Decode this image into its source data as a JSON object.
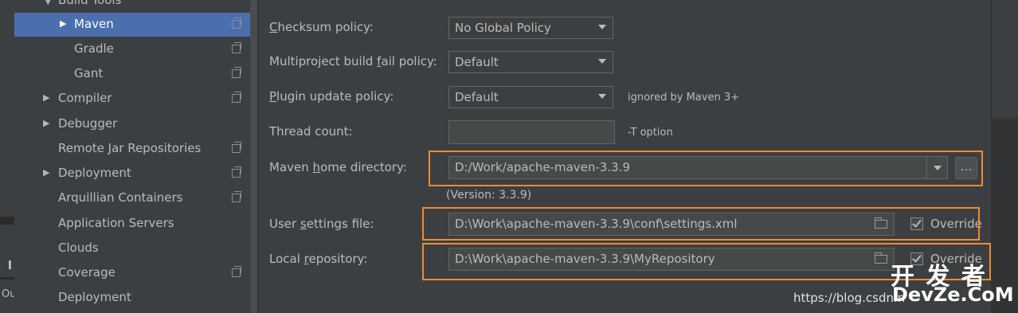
{
  "left_edge": {
    "top_label": "l",
    "bottom_label": "Ou"
  },
  "sidebar": {
    "items": [
      {
        "label": "Build Tools",
        "expanded": true
      },
      {
        "label": "Maven",
        "selected": true,
        "collapsed": true
      },
      {
        "label": "Gradle"
      },
      {
        "label": "Gant"
      },
      {
        "label": "Compiler",
        "collapsed": true
      },
      {
        "label": "Debugger",
        "collapsed": true
      },
      {
        "label": "Remote Jar Repositories"
      },
      {
        "label": "Deployment",
        "collapsed": true
      },
      {
        "label": "Arquillian Containers"
      },
      {
        "label": "Application Servers"
      },
      {
        "label": "Clouds"
      },
      {
        "label": "Coverage"
      },
      {
        "label": "Deployment"
      }
    ]
  },
  "form": {
    "checksum": {
      "label_underlined": "C",
      "label_rest": "hecksum policy:",
      "value": "No Global Policy"
    },
    "multiproject": {
      "label_pre": "Multiproject build ",
      "label_underlined": "f",
      "label_rest": "ail policy:",
      "value": "Default"
    },
    "plugin": {
      "label_underlined": "P",
      "label_rest": "lugin update policy:",
      "value": "Default",
      "hint": "ignored by Maven 3+"
    },
    "thread": {
      "label": "Thread count:",
      "value": "",
      "hint": "-T option"
    },
    "maven_home": {
      "label_pre": "Maven ",
      "label_underlined": "h",
      "label_rest": "ome directory:",
      "value": "D:/Work/apache-maven-3.3.9",
      "browse_label": "...",
      "version": "(Version: 3.3.9)"
    },
    "user_settings": {
      "label_pre": "User ",
      "label_underlined": "s",
      "label_rest": "ettings file:",
      "value": "D:\\Work\\apache-maven-3.3.9\\conf\\settings.xml",
      "override_label": "Override",
      "override_checked": true
    },
    "local_repo": {
      "label_pre": "Local ",
      "label_underlined": "r",
      "label_rest": "epository:",
      "value": "D:\\Work\\apache-maven-3.3.9\\MyRepository",
      "override_label": "Override",
      "override_checked": true
    }
  },
  "watermark": {
    "url": "https://blog.csdn.n",
    "brand_top": "开 发 者",
    "brand_bottom": "DevZe.CoM"
  },
  "colors": {
    "accent_selection": "#4b6eaf",
    "highlight_box": "#ef8a33",
    "background": "#3c3f41"
  }
}
